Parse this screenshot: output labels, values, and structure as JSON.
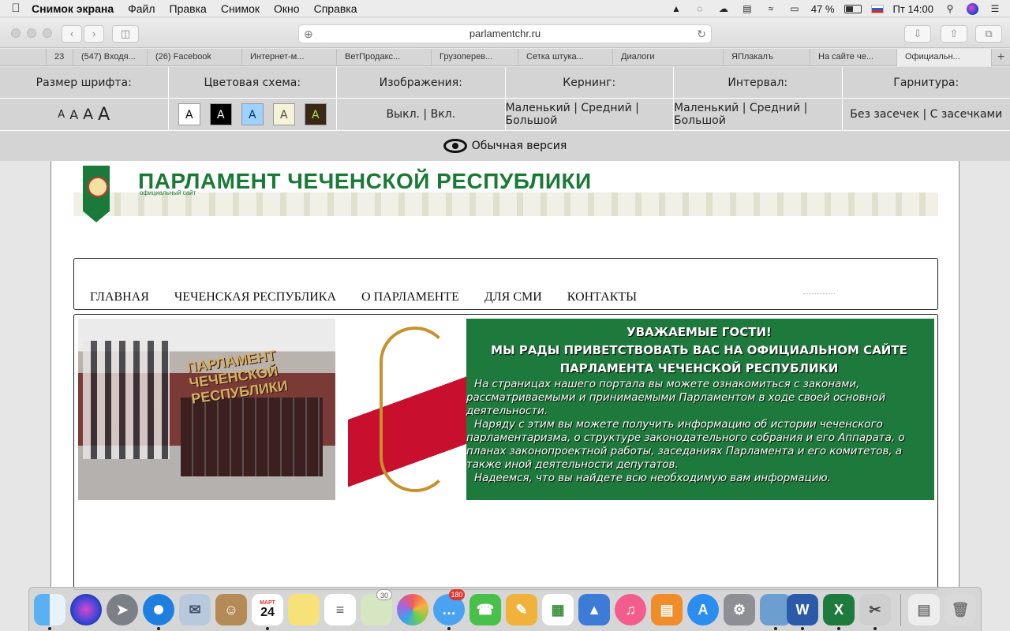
{
  "menubar": {
    "app_name": "Снимок экрана",
    "items": [
      "Файл",
      "Правка",
      "Снимок",
      "Окно",
      "Справка"
    ],
    "battery_percent": "47 %",
    "clock": "Пт 14:00"
  },
  "browser": {
    "url": "parlamentchr.ru",
    "tabs": [
      "23",
      "(547) Входя...",
      "(26) Facebook",
      "Интернет-м...",
      "ВетПродакс...",
      "Грузоперев...",
      "Сетка штука...",
      "Диалоги",
      "ЯПлакалъ",
      "На сайте че...",
      "Официальн..."
    ],
    "new_tab": "+"
  },
  "accessibility": {
    "columns": [
      {
        "label": "Размер шрифта:",
        "options": [
          "A",
          "A",
          "A",
          "A"
        ]
      },
      {
        "label": "Цветовая схема:",
        "options": [
          "A",
          "A",
          "A",
          "A",
          "A"
        ]
      },
      {
        "label": "Изображения:",
        "value": "Выкл.  | Вкл."
      },
      {
        "label": "Кернинг:",
        "value": "Маленький | Средний | Большой"
      },
      {
        "label": "Интервал:",
        "value": "Маленький | Средний | Большой"
      },
      {
        "label": "Гарнитура:",
        "value": "Без засечек | С засечками"
      }
    ],
    "color_schemes": [
      {
        "bg": "#ffffff",
        "fg": "#000000"
      },
      {
        "bg": "#000000",
        "fg": "#ffffff"
      },
      {
        "bg": "#9dd1ff",
        "fg": "#063462"
      },
      {
        "bg": "#f7f3d6",
        "fg": "#4d4b43"
      },
      {
        "bg": "#3b2716",
        "fg": "#a9e44d"
      }
    ],
    "normal_version": "Обычная версия"
  },
  "site": {
    "title": "ПАРЛАМЕНТ ЧЕЧЕНСКОЙ РЕСПУБЛИКИ",
    "subtitle": "официальный сайт",
    "nav": [
      "ГЛАВНАЯ",
      "ЧЕЧЕНСКАЯ РЕСПУБЛИКА",
      "О ПАРЛАМЕНТЕ",
      "ДЛЯ СМИ",
      "КОНТАКТЫ"
    ],
    "photo_label": "ПАРЛАМЕНТ ЧЕЧЕНСКОЙ РЕСПУБЛИКИ",
    "banner": {
      "heading_1": "УВАЖАЕМЫЕ ГОСТИ!",
      "heading_2": "МЫ РАДЫ ПРИВЕТСТВОВАТЬ ВАС НА ОФИЦИАЛЬНОМ САЙТЕ",
      "heading_3": "ПАРЛАМЕНТА ЧЕЧЕНСКОЙ РЕСПУБЛИКИ",
      "para_1": "На страницах нашего портала вы можете ознакомиться с законами, рассматриваемыми и принимаемыми Парламентом в ходе своей основной деятельности.",
      "para_2": "Наряду с этим вы можете получить информацию об истории чеченского парламентаризма, о структуре законодательного собрания и его Аппарата, о планах законопроектной работы, заседаниях Парламента и его комитетов, а также иной деятельности депутатов.",
      "para_3": "Надеемся, что вы найдете всю необходимую вам информацию."
    }
  },
  "dock": {
    "calendar_month": "МАРТ",
    "calendar_day": "24",
    "messages_badge": "180",
    "calendar_badge": "30"
  }
}
